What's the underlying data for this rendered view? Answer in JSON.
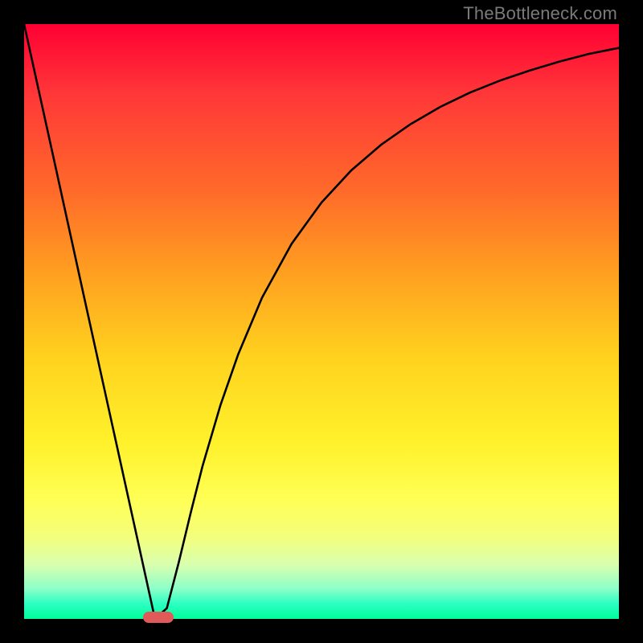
{
  "watermark": "TheBottleneck.com",
  "chart_data": {
    "type": "line",
    "title": "",
    "xlabel": "",
    "ylabel": "",
    "xlim": [
      0,
      1
    ],
    "ylim": [
      0,
      1
    ],
    "series": [
      {
        "name": "curve",
        "x": [
          0.0,
          0.05,
          0.1,
          0.15,
          0.2,
          0.22,
          0.24,
          0.26,
          0.28,
          0.3,
          0.33,
          0.36,
          0.4,
          0.45,
          0.5,
          0.55,
          0.6,
          0.65,
          0.7,
          0.75,
          0.8,
          0.85,
          0.9,
          0.95,
          1.0
        ],
        "y": [
          1.0,
          0.773,
          0.545,
          0.318,
          0.091,
          0.0,
          0.018,
          0.095,
          0.178,
          0.257,
          0.359,
          0.445,
          0.54,
          0.631,
          0.7,
          0.754,
          0.797,
          0.832,
          0.861,
          0.885,
          0.905,
          0.922,
          0.937,
          0.95,
          0.96
        ]
      }
    ],
    "marker": {
      "x": 0.225,
      "y": 0.003
    },
    "background_gradient": {
      "top": "#ff0033",
      "bottom": "#00ff99"
    }
  }
}
